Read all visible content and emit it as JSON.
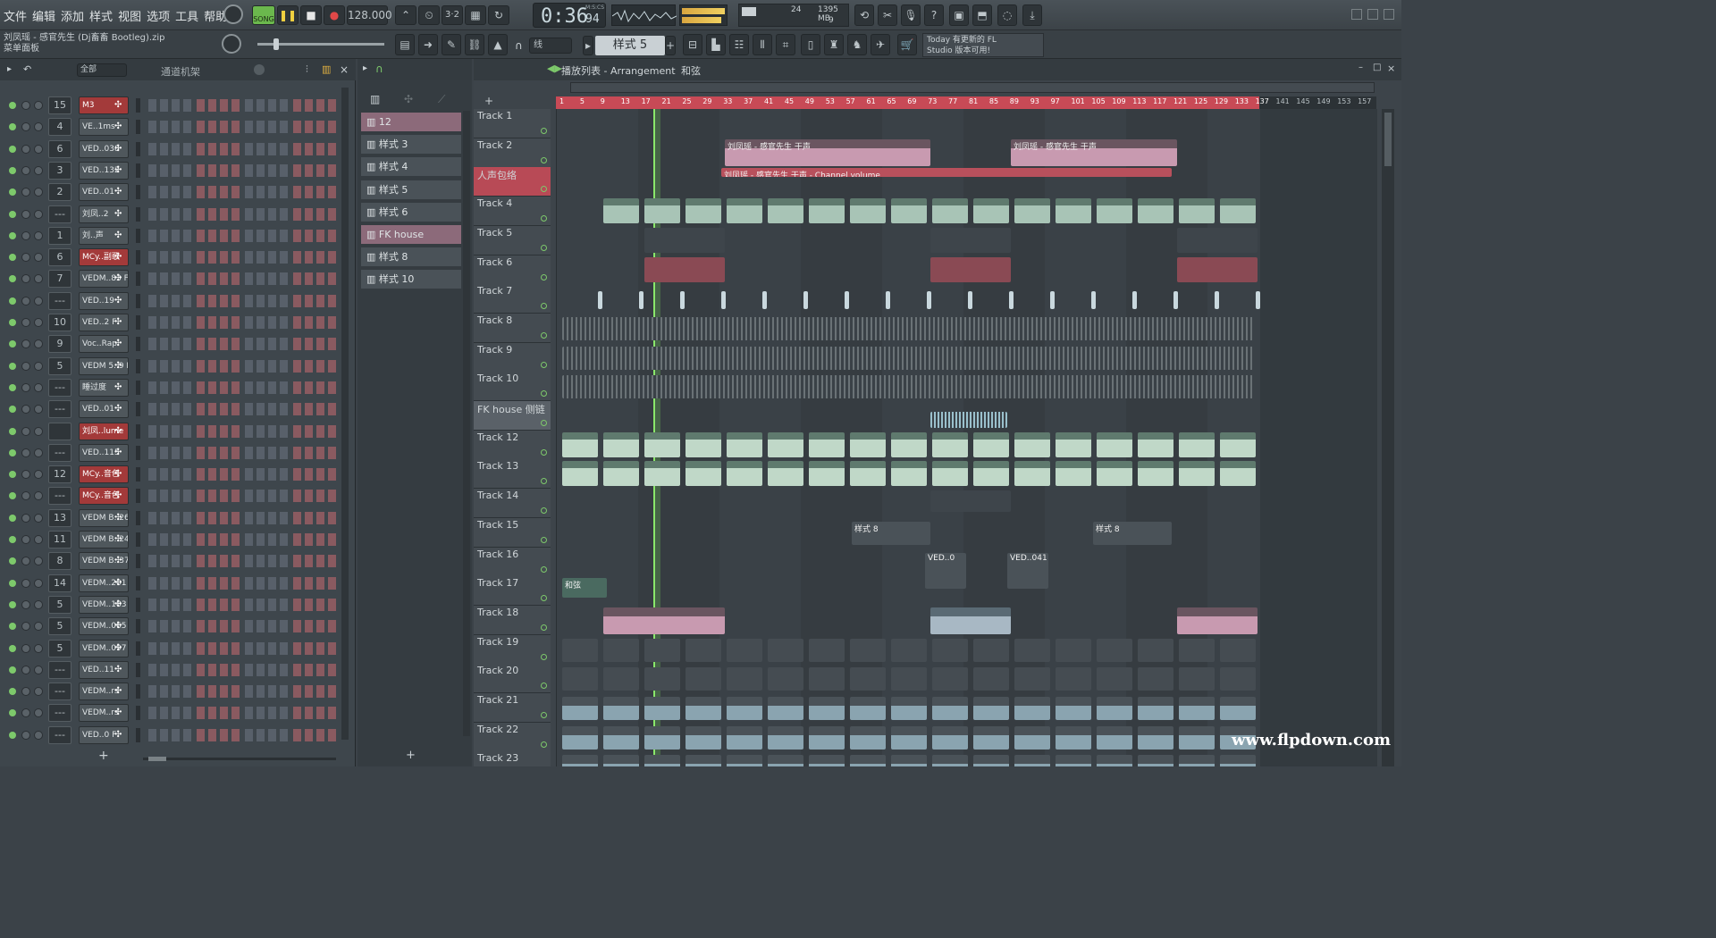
{
  "menu": [
    "文件",
    "编辑",
    "添加",
    "样式",
    "视图",
    "选项",
    "工具",
    "帮助"
  ],
  "transport": {
    "song_label": "SONG",
    "tempo": "128.000",
    "time": "0:36",
    "time_ms": "94",
    "time_unit": "M:S:CS"
  },
  "cpu": {
    "value1": "24",
    "mem": "1395 MB",
    "value2": "9"
  },
  "hint": {
    "file": "刘凤瑶 - 感官先生 (Dj畜畜 Bootleg).zip",
    "panel": "菜单面板"
  },
  "snap": "线",
  "pattern_select": "样式 5",
  "news": {
    "line1": "Today  有更新的 FL",
    "line2": "Studio 版本可用!"
  },
  "rack": {
    "filter": "全部",
    "title": "通道机架"
  },
  "channels": [
    {
      "num": "15",
      "name": "M3",
      "red": true
    },
    {
      "num": "4",
      "name": "VE..1ms",
      "red": false
    },
    {
      "num": "6",
      "name": "VED..038",
      "red": false
    },
    {
      "num": "3",
      "name": "VED..132",
      "red": false
    },
    {
      "num": "2",
      "name": "VED..01",
      "red": false
    },
    {
      "num": "---",
      "name": "刘凤..2",
      "red": false
    },
    {
      "num": "1",
      "name": "刘..声",
      "red": false
    },
    {
      "num": "6",
      "name": "MCy..副歌",
      "red": true
    },
    {
      "num": "7",
      "name": "VEDM..83 F#",
      "red": false
    },
    {
      "num": "---",
      "name": "VED..19",
      "red": false
    },
    {
      "num": "10",
      "name": "VED..2 F",
      "red": false
    },
    {
      "num": "9",
      "name": "Voc..Rap",
      "red": false
    },
    {
      "num": "5",
      "name": "VEDM 5..9 D#",
      "red": false
    },
    {
      "num": "---",
      "name": "睡过度",
      "red": false
    },
    {
      "num": "---",
      "name": "VED..01",
      "red": false
    },
    {
      "num": "",
      "name": "刘凤..lume",
      "red": true
    },
    {
      "num": "---",
      "name": "VED..115",
      "red": false
    },
    {
      "num": "12",
      "name": "MCy..音色",
      "red": true
    },
    {
      "num": "---",
      "name": "MCy..音色",
      "red": true
    },
    {
      "num": "13",
      "name": "VEDM B..26 F",
      "red": false
    },
    {
      "num": "11",
      "name": "VEDM B..24 F",
      "red": false
    },
    {
      "num": "8",
      "name": "VEDM B..37 E",
      "red": false
    },
    {
      "num": "14",
      "name": "VEDM..201 F",
      "red": false
    },
    {
      "num": "5",
      "name": "VEDM..183 A",
      "red": false
    },
    {
      "num": "5",
      "name": "VEDM..065 C",
      "red": false
    },
    {
      "num": "5",
      "name": "VEDM..097 B",
      "red": false
    },
    {
      "num": "---",
      "name": "VED..11",
      "red": false
    },
    {
      "num": "---",
      "name": "VEDM..rs",
      "red": false
    },
    {
      "num": "---",
      "name": "VEDM..rs",
      "red": false
    },
    {
      "num": "---",
      "name": "VED..0 F",
      "red": false
    }
  ],
  "patterns": [
    {
      "name": "12",
      "sel": true
    },
    {
      "name": "样式 3",
      "sel": false
    },
    {
      "name": "样式 4",
      "sel": false
    },
    {
      "name": "样式 5",
      "sel": false
    },
    {
      "name": "样式 6",
      "sel": false
    },
    {
      "name": "FK house",
      "sel": true
    },
    {
      "name": "样式 8",
      "sel": false
    },
    {
      "name": "样式 10",
      "sel": false
    }
  ],
  "arrangement": {
    "title": "播放列表 - Arrangement",
    "crumb": "和弦"
  },
  "ruler": [
    "1",
    "5",
    "9",
    "13",
    "17",
    "21",
    "25",
    "29",
    "33",
    "37",
    "41",
    "45",
    "49",
    "53",
    "57",
    "61",
    "65",
    "69",
    "73",
    "77",
    "81",
    "85",
    "89",
    "93",
    "97",
    "101",
    "105",
    "109",
    "113",
    "117",
    "121",
    "125",
    "129",
    "133",
    "137",
    "141",
    "145",
    "149",
    "153",
    "157"
  ],
  "tracks": [
    "Track 1",
    "Track 2",
    "人声包络",
    "Track 4",
    "Track 5",
    "Track 6",
    "Track 7",
    "Track 8",
    "Track 9",
    "Track 10",
    "FK house 侧链",
    "Track 12",
    "Track 13",
    "Track 14",
    "Track 15",
    "Track 16",
    "Track 17",
    "Track 18",
    "Track 19",
    "Track 20",
    "Track 21",
    "Track 22",
    "Track 23"
  ],
  "clip_labels": {
    "vocal1": "刘凤瑶 - 感官先生 干声",
    "vocal2": "刘凤瑶 - 感官先生 干声",
    "env": "刘凤瑶 - 感官先生 干声 - Channel volume",
    "chord": "和弦",
    "p8a": "样式 8",
    "p8b": "样式 8",
    "ved041": "VED..041",
    "ved0": "VED..0"
  },
  "watermark": "www.flpdown.com"
}
